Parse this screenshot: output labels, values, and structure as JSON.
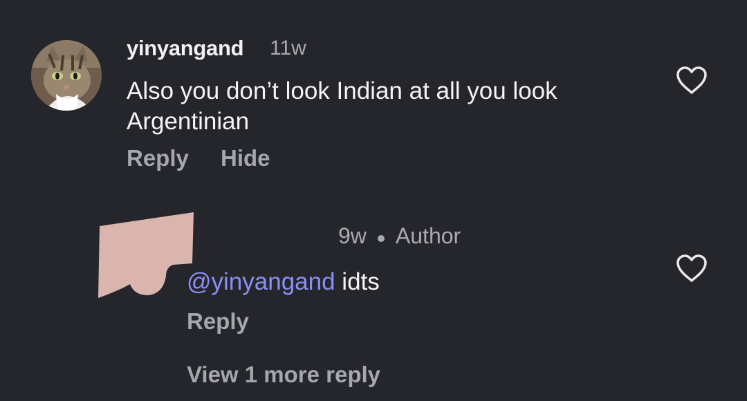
{
  "comment": {
    "username": "yinyangand",
    "age": "11w",
    "text": "Also you don’t look Indian at all you look Argentinian",
    "reply_label": "Reply",
    "hide_label": "Hide",
    "like_icon": "heart-outline-icon"
  },
  "reply": {
    "age": "9w",
    "badge": "Author",
    "mention": "@yinyangand",
    "text": " idts",
    "reply_label": "Reply",
    "like_icon": "heart-outline-icon"
  },
  "view_more_label": "View 1 more reply",
  "colors": {
    "background": "#25262b",
    "primary_text": "#f4f4f6",
    "secondary_text": "#a9aab0",
    "mention": "#8b8ff5",
    "redaction": "#d9b5ae"
  }
}
